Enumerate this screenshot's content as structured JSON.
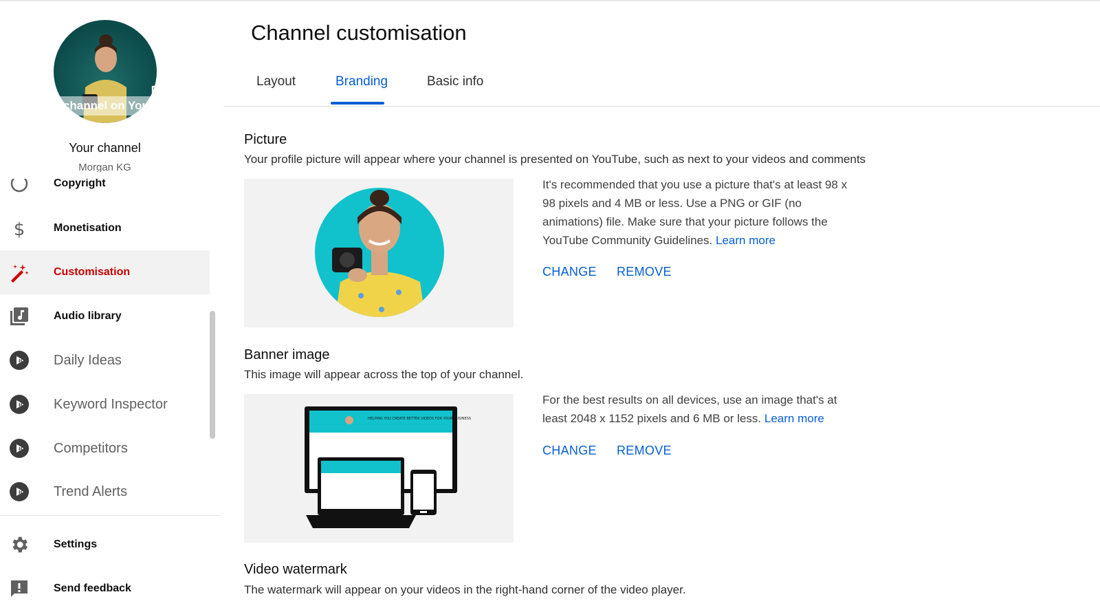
{
  "sidebar": {
    "view_channel_overlay": "View channel on YouTube",
    "your_channel": "Your channel",
    "channel_name": "Morgan KG",
    "items": [
      {
        "label": "Copyright",
        "icon": "copyright-icon"
      },
      {
        "label": "Monetisation",
        "icon": "dollar-icon"
      },
      {
        "label": "Customisation",
        "icon": "magic-wand-icon",
        "active": true
      },
      {
        "label": "Audio library",
        "icon": "audio-library-icon"
      },
      {
        "label": "Daily Ideas",
        "icon": "vidiq-icon"
      },
      {
        "label": "Keyword Inspector",
        "icon": "vidiq-icon"
      },
      {
        "label": "Competitors",
        "icon": "vidiq-icon"
      },
      {
        "label": "Trend Alerts",
        "icon": "vidiq-icon"
      },
      {
        "label": "Settings",
        "icon": "gear-icon"
      },
      {
        "label": "Send feedback",
        "icon": "feedback-icon"
      }
    ]
  },
  "main": {
    "title": "Channel customisation",
    "tabs": [
      {
        "label": "Layout"
      },
      {
        "label": "Branding",
        "active": true
      },
      {
        "label": "Basic info"
      }
    ],
    "picture": {
      "title": "Picture",
      "description": "Your profile picture will appear where your channel is presented on YouTube, such as next to your videos and comments",
      "info": "It's recommended that you use a picture that's at least 98 x 98 pixels and 4 MB or less. Use a PNG or GIF (no animations) file. Make sure that your picture follows the YouTube Community Guidelines.",
      "learn_more": "Learn more",
      "change": "CHANGE",
      "remove": "REMOVE"
    },
    "banner": {
      "title": "Banner image",
      "description": "This image will appear across the top of your channel.",
      "info": "For the best results on all devices, use an image that's at least 2048 x 1152 pixels and 6 MB or less.",
      "learn_more": "Learn more",
      "change": "CHANGE",
      "remove": "REMOVE",
      "banner_text": "HELPING YOU CREATE BETTER VIDEOS FOR YOUR BUSINESS"
    },
    "watermark": {
      "title": "Video watermark",
      "description": "The watermark will appear on your videos in the right-hand corner of the video player."
    }
  },
  "colors": {
    "accent": "#065fd4",
    "active_nav": "#cc0000",
    "avatar_bg": "#11c2cc"
  }
}
